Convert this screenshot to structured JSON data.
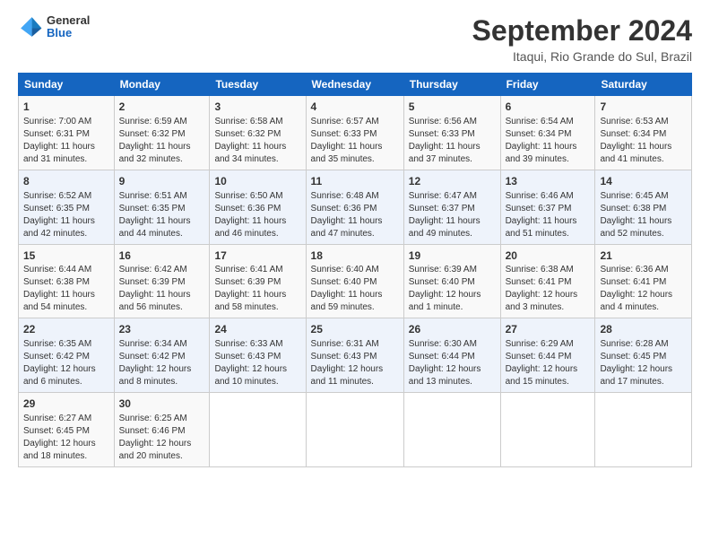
{
  "header": {
    "logo_line1": "General",
    "logo_line2": "Blue",
    "title": "September 2024",
    "subtitle": "Itaqui, Rio Grande do Sul, Brazil"
  },
  "weekdays": [
    "Sunday",
    "Monday",
    "Tuesday",
    "Wednesday",
    "Thursday",
    "Friday",
    "Saturday"
  ],
  "weeks": [
    [
      {
        "day": "1",
        "sunrise": "7:00 AM",
        "sunset": "6:31 PM",
        "daylight": "11 hours and 31 minutes."
      },
      {
        "day": "2",
        "sunrise": "6:59 AM",
        "sunset": "6:32 PM",
        "daylight": "11 hours and 32 minutes."
      },
      {
        "day": "3",
        "sunrise": "6:58 AM",
        "sunset": "6:32 PM",
        "daylight": "11 hours and 34 minutes."
      },
      {
        "day": "4",
        "sunrise": "6:57 AM",
        "sunset": "6:33 PM",
        "daylight": "11 hours and 35 minutes."
      },
      {
        "day": "5",
        "sunrise": "6:56 AM",
        "sunset": "6:33 PM",
        "daylight": "11 hours and 37 minutes."
      },
      {
        "day": "6",
        "sunrise": "6:54 AM",
        "sunset": "6:34 PM",
        "daylight": "11 hours and 39 minutes."
      },
      {
        "day": "7",
        "sunrise": "6:53 AM",
        "sunset": "6:34 PM",
        "daylight": "11 hours and 41 minutes."
      }
    ],
    [
      {
        "day": "8",
        "sunrise": "6:52 AM",
        "sunset": "6:35 PM",
        "daylight": "11 hours and 42 minutes."
      },
      {
        "day": "9",
        "sunrise": "6:51 AM",
        "sunset": "6:35 PM",
        "daylight": "11 hours and 44 minutes."
      },
      {
        "day": "10",
        "sunrise": "6:50 AM",
        "sunset": "6:36 PM",
        "daylight": "11 hours and 46 minutes."
      },
      {
        "day": "11",
        "sunrise": "6:48 AM",
        "sunset": "6:36 PM",
        "daylight": "11 hours and 47 minutes."
      },
      {
        "day": "12",
        "sunrise": "6:47 AM",
        "sunset": "6:37 PM",
        "daylight": "11 hours and 49 minutes."
      },
      {
        "day": "13",
        "sunrise": "6:46 AM",
        "sunset": "6:37 PM",
        "daylight": "11 hours and 51 minutes."
      },
      {
        "day": "14",
        "sunrise": "6:45 AM",
        "sunset": "6:38 PM",
        "daylight": "11 hours and 52 minutes."
      }
    ],
    [
      {
        "day": "15",
        "sunrise": "6:44 AM",
        "sunset": "6:38 PM",
        "daylight": "11 hours and 54 minutes."
      },
      {
        "day": "16",
        "sunrise": "6:42 AM",
        "sunset": "6:39 PM",
        "daylight": "11 hours and 56 minutes."
      },
      {
        "day": "17",
        "sunrise": "6:41 AM",
        "sunset": "6:39 PM",
        "daylight": "11 hours and 58 minutes."
      },
      {
        "day": "18",
        "sunrise": "6:40 AM",
        "sunset": "6:40 PM",
        "daylight": "11 hours and 59 minutes."
      },
      {
        "day": "19",
        "sunrise": "6:39 AM",
        "sunset": "6:40 PM",
        "daylight": "12 hours and 1 minute."
      },
      {
        "day": "20",
        "sunrise": "6:38 AM",
        "sunset": "6:41 PM",
        "daylight": "12 hours and 3 minutes."
      },
      {
        "day": "21",
        "sunrise": "6:36 AM",
        "sunset": "6:41 PM",
        "daylight": "12 hours and 4 minutes."
      }
    ],
    [
      {
        "day": "22",
        "sunrise": "6:35 AM",
        "sunset": "6:42 PM",
        "daylight": "12 hours and 6 minutes."
      },
      {
        "day": "23",
        "sunrise": "6:34 AM",
        "sunset": "6:42 PM",
        "daylight": "12 hours and 8 minutes."
      },
      {
        "day": "24",
        "sunrise": "6:33 AM",
        "sunset": "6:43 PM",
        "daylight": "12 hours and 10 minutes."
      },
      {
        "day": "25",
        "sunrise": "6:31 AM",
        "sunset": "6:43 PM",
        "daylight": "12 hours and 11 minutes."
      },
      {
        "day": "26",
        "sunrise": "6:30 AM",
        "sunset": "6:44 PM",
        "daylight": "12 hours and 13 minutes."
      },
      {
        "day": "27",
        "sunrise": "6:29 AM",
        "sunset": "6:44 PM",
        "daylight": "12 hours and 15 minutes."
      },
      {
        "day": "28",
        "sunrise": "6:28 AM",
        "sunset": "6:45 PM",
        "daylight": "12 hours and 17 minutes."
      }
    ],
    [
      {
        "day": "29",
        "sunrise": "6:27 AM",
        "sunset": "6:45 PM",
        "daylight": "12 hours and 18 minutes."
      },
      {
        "day": "30",
        "sunrise": "6:25 AM",
        "sunset": "6:46 PM",
        "daylight": "12 hours and 20 minutes."
      },
      null,
      null,
      null,
      null,
      null
    ]
  ]
}
